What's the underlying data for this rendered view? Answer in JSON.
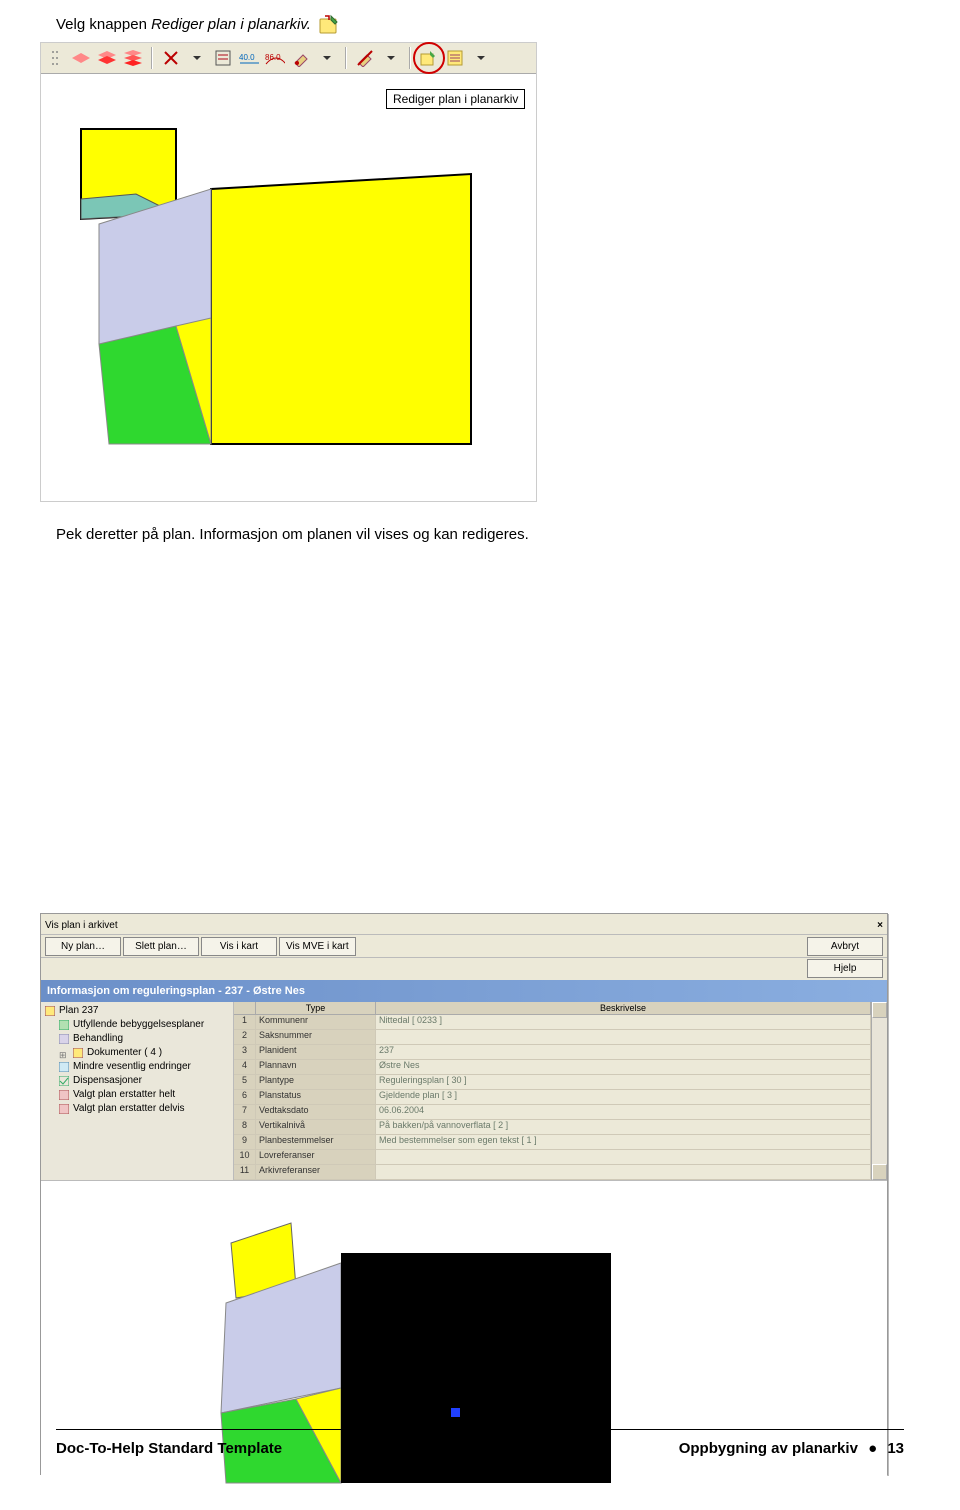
{
  "intro": {
    "prefix": "Velg knappen ",
    "italic": "Rediger plan i planarkiv.",
    "icon_name": "plan-edit-icon"
  },
  "shot1": {
    "tooltip": "Rediger plan i planarkiv",
    "tooltip_icon_name": "plan-edit-highlighted-icon"
  },
  "body2": "Pek deretter på plan. Informasjon om planen vil vises og kan redigeres.",
  "shot2": {
    "top_title": "Vis plan i arkivet",
    "close_icon": "×",
    "buttons_left": [
      "Ny plan…",
      "Slett plan…",
      "Vis i kart",
      "Vis MVE i kart"
    ],
    "buttons_right": [
      "Avbryt",
      "Hjelp"
    ],
    "titlebar": "Informasjon om reguleringsplan - 237 - Østre Nes",
    "tree": [
      "Plan 237",
      "Utfyllende bebyggelsesplaner",
      "Behandling",
      "Dokumenter ( 4 )",
      "Mindre vesentlig endringer",
      "Dispensasjoner",
      "Valgt plan erstatter helt",
      "Valgt plan erstatter delvis"
    ],
    "grid_headers": [
      "",
      "Type",
      "Beskrivelse"
    ],
    "rows": [
      {
        "n": "1",
        "type": "Kommunenr",
        "val": "Nittedal [ 0233 ]",
        "sel": true
      },
      {
        "n": "2",
        "type": "Saksnummer",
        "val": ""
      },
      {
        "n": "3",
        "type": "Planident",
        "val": "237"
      },
      {
        "n": "4",
        "type": "Plannavn",
        "val": "Østre Nes"
      },
      {
        "n": "5",
        "type": "Plantype",
        "val": "Reguleringsplan [ 30 ]"
      },
      {
        "n": "6",
        "type": "Planstatus",
        "val": "Gjeldende plan [ 3 ]"
      },
      {
        "n": "7",
        "type": "Vedtaksdato",
        "val": "06.06.2004"
      },
      {
        "n": "8",
        "type": "Vertikalnivå",
        "val": "På bakken/på vannoverflata [ 2 ]"
      },
      {
        "n": "9",
        "type": "Planbestemmelser",
        "val": "Med bestemmelser som egen tekst [ 1 ]"
      },
      {
        "n": "10",
        "type": "Lovreferanser",
        "val": ""
      },
      {
        "n": "11",
        "type": "Arkivreferanser",
        "val": ""
      }
    ]
  },
  "footer": {
    "left": "Doc-To-Help Standard Template",
    "right_section": "Oppbygning av planarkiv",
    "bullet": "●",
    "page": "13"
  }
}
